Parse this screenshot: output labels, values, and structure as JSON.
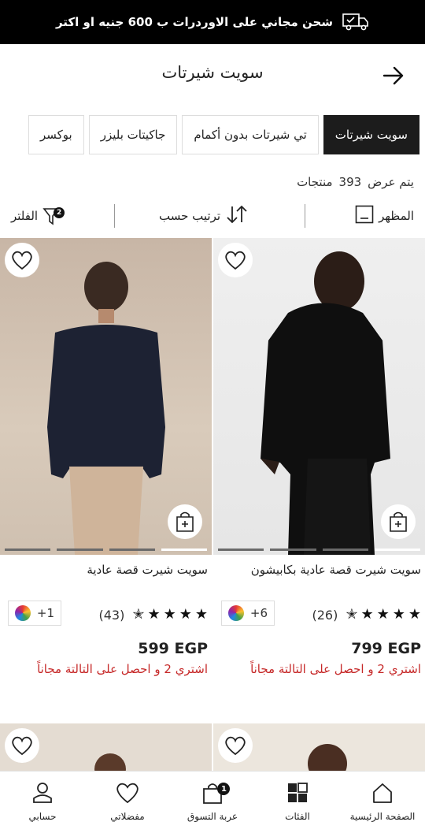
{
  "promo_bar": {
    "text": "شحن مجاني على الاوردرات ب 600 جنيه او اكتر",
    "icon": "truck-icon"
  },
  "header": {
    "title": "سويت شيرتات",
    "back_icon": "arrow-right-icon"
  },
  "categories": [
    {
      "label": "سويت شيرتات",
      "active": true
    },
    {
      "label": "تي شيرتات بدون أكمام",
      "active": false
    },
    {
      "label": "جاكيتات بليزر",
      "active": false
    },
    {
      "label": "بوكسر",
      "active": false
    }
  ],
  "results": {
    "prefix": "يتم عرض",
    "count": "393",
    "suffix": "منتجات"
  },
  "toolbar": {
    "view_label": "المظهر",
    "sort_label": "ترتيب حسب",
    "filter_label": "الفلتر",
    "filter_badge": "2"
  },
  "products": [
    {
      "name": "سويت شيرت قصة عادية بكابيشون",
      "rating_count": "(26)",
      "colors": "+6",
      "price": "799 EGP",
      "promo": "اشتري 2 و احصل على التالتة مجاناً",
      "stars": 4.5
    },
    {
      "name": "سويت شيرت قصة عادية",
      "rating_count": "(43)",
      "colors": "+1",
      "price": "599 EGP",
      "promo": "اشتري 2 و احصل على التالتة مجاناً",
      "stars": 4.5
    }
  ],
  "bottom_nav": [
    {
      "label": "الصفحة الرئيسية",
      "icon": "home-icon"
    },
    {
      "label": "الفئات",
      "icon": "categories-icon"
    },
    {
      "label": "عربة التسوق",
      "icon": "cart-icon",
      "badge": "1"
    },
    {
      "label": "مفضلاتي",
      "icon": "heart-icon"
    },
    {
      "label": "حسابي",
      "icon": "user-icon"
    }
  ],
  "colors": {
    "promo_red": "#c62828",
    "active_chip": "#1c1c1c"
  }
}
